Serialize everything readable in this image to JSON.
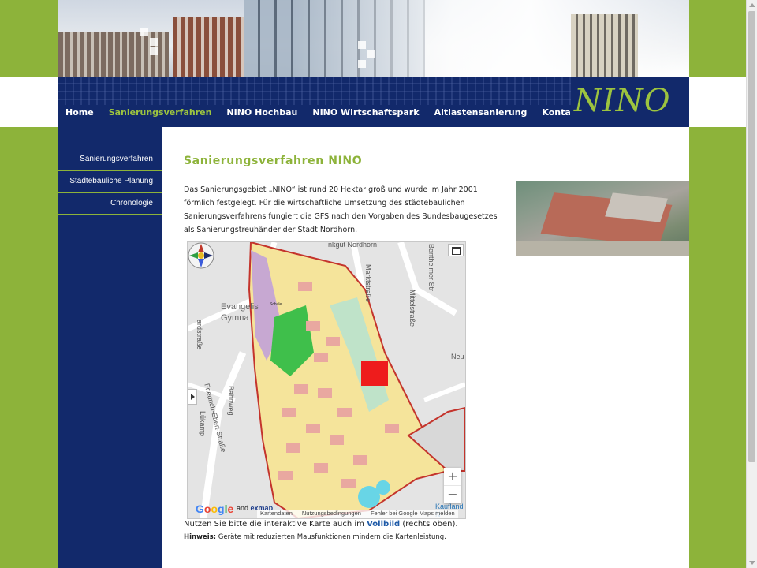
{
  "nav": {
    "items": [
      {
        "label": "Home",
        "active": false
      },
      {
        "label": "Sanierungsverfahren",
        "active": true
      },
      {
        "label": "NINO Hochbau",
        "active": false
      },
      {
        "label": "NINO Wirtschaftspark",
        "active": false
      },
      {
        "label": "Altlastensanierung",
        "active": false
      },
      {
        "label": "Kontakt",
        "active": false
      }
    ]
  },
  "logo": {
    "text": "NINO"
  },
  "sidebar": {
    "items": [
      {
        "label": "Sanierungsverfahren"
      },
      {
        "label": "Städtebauliche Planung"
      },
      {
        "label": "Chronologie"
      }
    ]
  },
  "main": {
    "title": "Sanierungsverfahren NINO",
    "intro": "Das Sanierungsgebiet „NINO“ ist rund 20 Hektar groß und wurde im Jahr 2001 förmlich festgelegt. Für die wirtschaftliche Umsetzung des städtebaulichen Sanierungsverfahrens fungiert die GFS nach den Vorgaben des Bundesbaugesetzes als Sanierungstreuhänder der Stadt Nordhorn.",
    "map": {
      "labels": {
        "top": "nkgut Nordhorn",
        "marktstrasse": "Marktstraße",
        "mittelstrasse": "Mittelstraße",
        "bentheimer": "Bentheimer Str",
        "neu": "Neu",
        "evangel": "Evangelis",
        "gymn": "Gymna",
        "schule": "Schule",
        "ardstrasse": "ardstraße",
        "friedrich": "Friedrich-Ebert-Straße",
        "luekamp": "Lükamp",
        "bahnweg": "Bahnweg",
        "kaufland": "Kaufland N"
      },
      "zoom_in": "+",
      "zoom_out": "−",
      "google": [
        "G",
        "o",
        "o",
        "g",
        "l",
        "e"
      ],
      "and_text": "and",
      "exmap_text": "exmap",
      "attribution": [
        "Kartendaten",
        "Nutzungsbedingungen",
        "Fehler bei Google Maps melden"
      ]
    },
    "note_prefix": "Nutzen Sie bitte die interaktive Karte auch im",
    "note_link": "Vollbild",
    "note_suffix": "(rechts oben).",
    "hint_label": "Hinweis:",
    "hint_text": "Geräte mit reduzierten Mausfunktionen mindern die Kartenleistung."
  },
  "colors": {
    "green": "#8db33a",
    "navy": "#12296b",
    "link": "#1e5aa8"
  }
}
